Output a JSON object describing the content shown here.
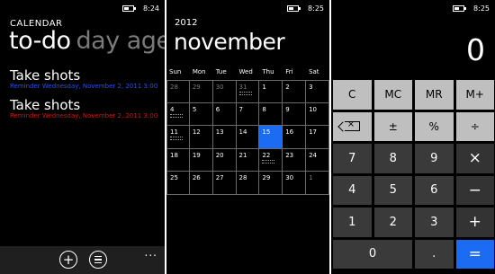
{
  "status": {
    "time_1": "8:24",
    "time_2": "8:25",
    "time_3": "8:25"
  },
  "calendar_list": {
    "app_title": "CALENDAR",
    "pivot_active": "to-do",
    "pivot_next": "day agen",
    "items": [
      {
        "title": "Take shots",
        "reminder": "Reminder Wednesday, November 2, 2011 3:00",
        "reminder_color": "#2a50e6"
      },
      {
        "title": "Take shots",
        "reminder": "Reminder Wednesday, November 2, 2011 3:00",
        "reminder_color": "#d01515"
      }
    ],
    "appbar": {
      "add_icon": "plus-circle-icon",
      "list_icon": "list-circle-icon",
      "more": "..."
    }
  },
  "month_view": {
    "year": "2012",
    "month": "november",
    "weekdays": [
      "Sun",
      "Mon",
      "Tue",
      "Wed",
      "Thu",
      "Fri",
      "Sat"
    ],
    "weeks": [
      [
        "28",
        "29",
        "30",
        "31",
        "1",
        "2",
        "3"
      ],
      [
        "4",
        "5",
        "6",
        "7",
        "8",
        "9",
        "10"
      ],
      [
        "11",
        "12",
        "13",
        "14",
        "15",
        "16",
        "17"
      ],
      [
        "18",
        "19",
        "20",
        "21",
        "22",
        "23",
        "24"
      ],
      [
        "25",
        "26",
        "27",
        "28",
        "29",
        "30",
        "1"
      ]
    ],
    "selected_day": "15",
    "accent_color": "#1b6cf2"
  },
  "calculator": {
    "display": "0",
    "keys": [
      [
        "C",
        "MC",
        "MR",
        "M+"
      ],
      [
        "backspace",
        "±",
        "%",
        "÷"
      ],
      [
        "7",
        "8",
        "9",
        "×"
      ],
      [
        "4",
        "5",
        "6",
        "−"
      ],
      [
        "1",
        "2",
        "3",
        "+"
      ],
      [
        "0",
        ".",
        "="
      ]
    ]
  }
}
